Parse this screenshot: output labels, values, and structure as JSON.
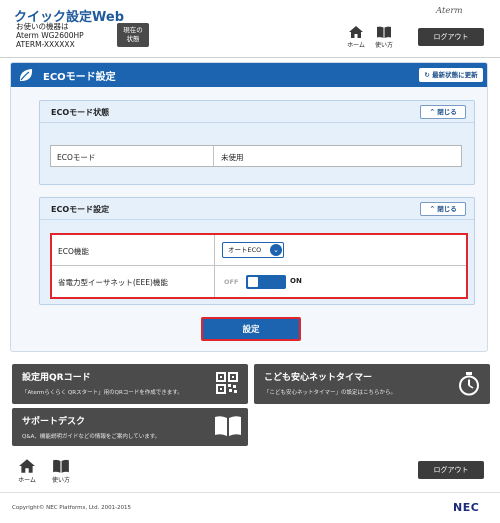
{
  "header": {
    "app_title": "クイック設定Web",
    "device_line1": "お使いの機器は",
    "device_line2": "Aterm WG2600HP",
    "device_line3": "ATERM-XXXXXX",
    "status_line1": "現在の",
    "status_line2": "状態",
    "brand": "Aterm",
    "home_label": "ホーム",
    "help_label": "使い方",
    "logout_label": "ログアウト"
  },
  "main": {
    "title": "ECOモード設定",
    "refresh_label": "最新状態に更新",
    "status_section": {
      "title": "ECOモード状態",
      "close_label": "閉じる",
      "rows": [
        {
          "label": "ECOモード",
          "value": "未使用"
        }
      ]
    },
    "settings_section": {
      "title": "ECOモード設定",
      "close_label": "閉じる",
      "eco_label": "ECO機能",
      "eco_selected": "オートECO",
      "eee_label": "省電力型イーサネット(EEE)機能",
      "toggle_off": "OFF",
      "toggle_on": "ON",
      "eee_state": "ON"
    },
    "apply_label": "設定"
  },
  "quick_links": {
    "qr_title": "設定用QRコード",
    "qr_desc": "「Atermらくらく QRスタート」用のQRコードを作成できます。",
    "timer_title": "こども安心ネットタイマー",
    "timer_desc": "「こども安心ネットタイマー」の設定はこちらから。",
    "support_title": "サポートデスク",
    "support_desc": "Q&A、機能説明ガイドなどの情報をご案内しています。"
  },
  "footer": {
    "home_label": "ホーム",
    "help_label": "使い方",
    "logout_label": "ログアウト",
    "copyright": "Copyright© NEC Platforms, Ltd. 2001-2015",
    "logo": "NEC"
  },
  "colors": {
    "accent": "#1c63b0",
    "highlight": "#e0262c",
    "card": "#4b4b4b"
  }
}
